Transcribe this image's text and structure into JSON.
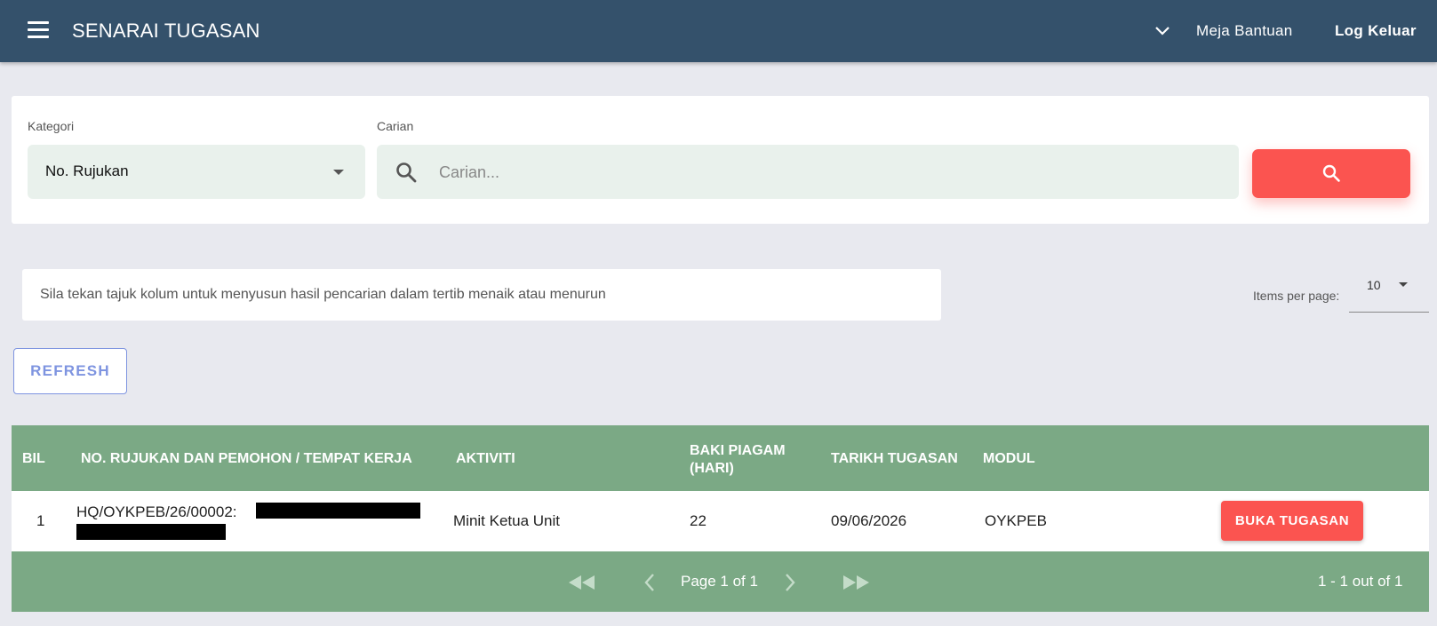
{
  "header": {
    "title": "SENARAI TUGASAN",
    "helpdesk_label": "Meja Bantuan",
    "logout_label": "Log Keluar"
  },
  "search": {
    "category_label": "Kategori",
    "category_value": "No. Rujukan",
    "search_label": "Carian",
    "search_placeholder": "Carian..."
  },
  "info": {
    "sort_hint": "Sila tekan tajuk kolum untuk menyusun hasil pencarian dalam tertib menaik atau menurun",
    "items_per_page_label": "Items per page:",
    "items_per_page_value": "10"
  },
  "refresh_label": "REFRESH",
  "table": {
    "headers": {
      "bil": "BIL",
      "rujukan": "NO. RUJUKAN DAN PEMOHON / TEMPAT KERJA",
      "aktiviti": "AKTIVITI",
      "baki_line1": "BAKI PIAGAM",
      "baki_line2": "(HARI)",
      "tarikh": "TARIKH TUGASAN",
      "modul": "MODUL"
    },
    "rows": [
      {
        "bil": "1",
        "rujukan": "HQ/OYKPEB/26/00002:",
        "aktiviti": "Minit Ketua Unit",
        "baki": "22",
        "tarikh": "09/06/2026",
        "modul": "OYKPEB",
        "action_label": "BUKA TUGASAN"
      }
    ]
  },
  "pagination": {
    "page_info": "Page 1 of 1",
    "range_info": "1 - 1 out of 1"
  },
  "colors": {
    "topbar": "#34516b",
    "accent_red": "#fb5450",
    "table_green": "#7ba985",
    "refresh_blue": "#7e94e0"
  }
}
